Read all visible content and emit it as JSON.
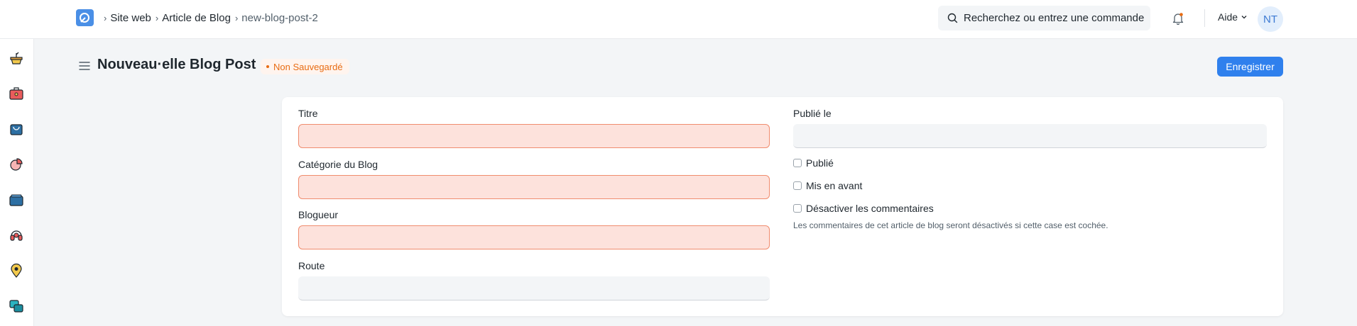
{
  "breadcrumb": {
    "items": [
      "Site web",
      "Article de Blog",
      "new-blog-post-2"
    ]
  },
  "search": {
    "placeholder": "Recherchez ou entrez une commande"
  },
  "header": {
    "help_label": "Aide",
    "avatar_initials": "NT"
  },
  "page": {
    "title": "Nouveau·elle Blog Post",
    "status": "Non Sauvegardé",
    "save_label": "Enregistrer"
  },
  "form": {
    "left_fields": [
      {
        "label": "Titre",
        "value": "",
        "required": true
      },
      {
        "label": "Catégorie du Blog",
        "value": "",
        "required": true
      },
      {
        "label": "Blogueur",
        "value": "",
        "required": true
      },
      {
        "label": "Route",
        "value": "",
        "required": false
      }
    ],
    "published_on": {
      "label": "Publié le",
      "value": ""
    },
    "checkboxes": [
      {
        "label": "Publié",
        "checked": false
      },
      {
        "label": "Mis en avant",
        "checked": false
      },
      {
        "label": "Désactiver les commentaires",
        "checked": false
      }
    ],
    "disable_comments_help": "Les commentaires de cet article de blog seront désactivés si cette case est cochée."
  },
  "colors": {
    "primary": "#2f80ed",
    "status_orange": "#e86c13",
    "required_bg": "#fde2dc",
    "required_border": "#f08c6e"
  },
  "icons": {
    "sidebar": [
      "pot-icon",
      "briefcase-icon",
      "shopping-bag-icon",
      "pie-chart-icon",
      "folder-icon",
      "headset-icon",
      "location-pin-icon",
      "chat-icon"
    ],
    "navbar": [
      "app-logo-icon",
      "search-icon",
      "bell-icon",
      "chevron-down-icon",
      "hamburger-icon"
    ]
  }
}
